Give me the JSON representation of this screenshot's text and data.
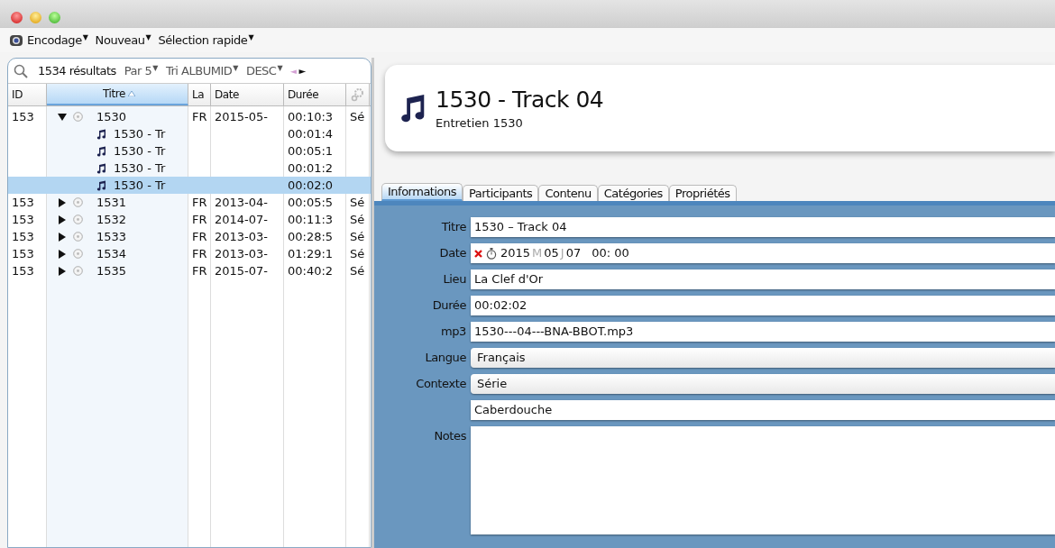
{
  "menu": [
    {
      "label": "Encodage",
      "caret": "▼"
    },
    {
      "label": "Nouveau",
      "caret": "▼"
    },
    {
      "label": "Sélection rapide",
      "caret": "▼"
    }
  ],
  "search": {
    "count": "1534 résultats",
    "controls": [
      {
        "label": "Par 5",
        "caret": "▼"
      },
      {
        "label": "Tri ALBUMID",
        "caret": "▼"
      },
      {
        "label": "DESC",
        "caret": "▼"
      }
    ],
    "prev": "◄",
    "next": "►"
  },
  "table": {
    "columns": [
      {
        "label": "ID",
        "sorted": false
      },
      {
        "label": "Titre",
        "sorted": true
      },
      {
        "label": "La",
        "sorted": false
      },
      {
        "label": "Date",
        "sorted": false
      },
      {
        "label": "Durée",
        "sorted": false
      }
    ],
    "rows": [
      {
        "id": "153",
        "title": "1530",
        "lang": "FR",
        "date": "2015-05-",
        "duration": "00:10:3",
        "column_6": "Sé",
        "expanded": true,
        "selected": false,
        "children": [
          {
            "title": "1530 - Tr",
            "duration": "00:01:4",
            "selected": false
          },
          {
            "title": "1530 - Tr",
            "duration": "00:05:1",
            "selected": false
          },
          {
            "title": "1530 - Tr",
            "duration": "00:01:2",
            "selected": false
          },
          {
            "title": "1530 - Tr",
            "duration": "00:02:0",
            "selected": true
          }
        ]
      },
      {
        "id": "153",
        "title": "1531",
        "lang": "FR",
        "date": "2013-04-",
        "duration": "00:05:5",
        "column_6": "Sé",
        "expanded": false,
        "selected": false
      },
      {
        "id": "153",
        "title": "1532",
        "lang": "FR",
        "date": "2014-07-",
        "duration": "00:11:3",
        "column_6": "Sé",
        "expanded": false,
        "selected": false
      },
      {
        "id": "153",
        "title": "1533",
        "lang": "FR",
        "date": "2013-03-",
        "duration": "00:28:5",
        "column_6": "Sé",
        "expanded": false,
        "selected": false
      },
      {
        "id": "153",
        "title": "1534",
        "lang": "FR",
        "date": "2013-03-",
        "duration": "01:29:1",
        "column_6": "Sé",
        "expanded": false,
        "selected": false
      },
      {
        "id": "153",
        "title": "1535",
        "lang": "FR",
        "date": "2015-07-",
        "duration": "00:40:2",
        "column_6": "Sé",
        "expanded": false,
        "selected": false
      }
    ]
  },
  "header": {
    "title": "1530 - Track 04",
    "subtitle": "Entretien 1530"
  },
  "tabs": [
    {
      "label": "Informations",
      "selected": true
    },
    {
      "label": "Participants",
      "selected": false
    },
    {
      "label": "Contenu",
      "selected": false
    },
    {
      "label": "Catégories",
      "selected": false
    },
    {
      "label": "Propriétés",
      "selected": false
    }
  ],
  "fields": [
    {
      "kind": "text",
      "label": "Titre",
      "value": "1530 – Track 04"
    },
    {
      "kind": "date",
      "label": "Date",
      "parts": [
        {
          "kind": "value",
          "text": "2015"
        },
        {
          "kind": "unit",
          "text": "M"
        },
        {
          "kind": "value",
          "text": "05"
        },
        {
          "kind": "unit",
          "text": "J"
        },
        {
          "kind": "value",
          "text": "07"
        },
        {
          "kind": "value",
          "text": "00: 00"
        }
      ]
    },
    {
      "kind": "text",
      "label": "Lieu",
      "value": "La Clef d'Or"
    },
    {
      "kind": "text",
      "label": "Durée",
      "value": "00:02:02"
    },
    {
      "kind": "text",
      "label": "mp3",
      "value": "1530---04---BNA-BBOT.mp3"
    },
    {
      "kind": "select",
      "label": "Langue",
      "value": "Français"
    },
    {
      "kind": "select",
      "label": "Contexte",
      "value": "Série"
    },
    {
      "kind": "text",
      "value": "Caberdouche"
    },
    {
      "kind": "notes",
      "label": "Notes"
    }
  ]
}
